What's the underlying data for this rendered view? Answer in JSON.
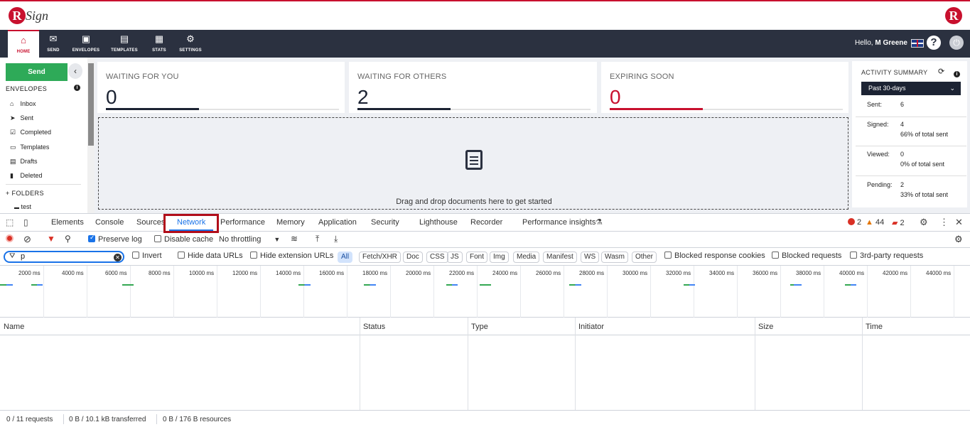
{
  "app": {
    "logo_text": "Sign",
    "logo_letter": "R",
    "nav": [
      {
        "label": "HOME",
        "icon": "home-icon",
        "glyph": "⌂"
      },
      {
        "label": "SEND",
        "icon": "envelope-icon",
        "glyph": "✉"
      },
      {
        "label": "ENVELOPES",
        "icon": "envelopes-icon",
        "glyph": "▣"
      },
      {
        "label": "TEMPLATES",
        "icon": "templates-icon",
        "glyph": "▤"
      },
      {
        "label": "STATS",
        "icon": "stats-icon",
        "glyph": "▦"
      },
      {
        "label": "SETTINGS",
        "icon": "gear-icon",
        "glyph": "⚙"
      }
    ],
    "greeting": "Hello,",
    "user_name": "M Greene",
    "help_glyph": "?",
    "power_glyph": "⏻"
  },
  "sidebar": {
    "send_label": "Send",
    "collapse_glyph": "‹",
    "envelopes_heading": "ENVELOPES",
    "info_glyph": "i",
    "items": [
      {
        "label": "Inbox",
        "glyph": "⌂"
      },
      {
        "label": "Sent",
        "glyph": "➤"
      },
      {
        "label": "Completed",
        "glyph": "☑"
      },
      {
        "label": "Templates",
        "glyph": "▭"
      },
      {
        "label": "Drafts",
        "glyph": "▤"
      },
      {
        "label": "Deleted",
        "glyph": "▮"
      }
    ],
    "folders_heading": "+ FOLDERS",
    "folder_items": [
      {
        "label": "test",
        "glyph": "▬"
      }
    ]
  },
  "dashboard": {
    "cards": [
      {
        "label": "WAITING FOR YOU",
        "value": "0"
      },
      {
        "label": "WAITING FOR OTHERS",
        "value": "2"
      },
      {
        "label": "EXPIRING SOON",
        "value": "0"
      }
    ],
    "drop_text": "Drag and drop documents here to get started"
  },
  "activity": {
    "title": "ACTIVITY SUMMARY",
    "period": "Past 30-days",
    "rows": [
      {
        "label": "Sent:",
        "value": "6",
        "pct": ""
      },
      {
        "label": "Signed:",
        "value": "4",
        "pct": "66% of total sent"
      },
      {
        "label": "Viewed:",
        "value": "0",
        "pct": "0% of total sent"
      },
      {
        "label": "Pending:",
        "value": "2",
        "pct": "33% of total sent"
      }
    ]
  },
  "devtools": {
    "tabs": [
      "Elements",
      "Console",
      "Sources",
      "Network",
      "Performance",
      "Memory",
      "Application",
      "Security",
      "Lighthouse",
      "Recorder",
      "Performance insights"
    ],
    "active_tab": "Network",
    "errors": "2",
    "warnings": "44",
    "issues": "2",
    "toolbar": {
      "preserve_log": "Preserve log",
      "disable_cache": "Disable cache",
      "throttling": "No throttling"
    },
    "filter": {
      "value": "p",
      "invert": "Invert",
      "hide_data_urls": "Hide data URLs",
      "hide_extension_urls": "Hide extension URLs",
      "chips": [
        "All",
        "Fetch/XHR",
        "Doc",
        "CSS",
        "JS",
        "Font",
        "Img",
        "Media",
        "Manifest",
        "WS",
        "Wasm",
        "Other"
      ],
      "blocked_cookies": "Blocked response cookies",
      "blocked_requests": "Blocked requests",
      "third_party": "3rd-party requests"
    },
    "timeline_ticks": [
      "2000 ms",
      "4000 ms",
      "6000 ms",
      "8000 ms",
      "10000 ms",
      "12000 ms",
      "14000 ms",
      "16000 ms",
      "18000 ms",
      "20000 ms",
      "22000 ms",
      "24000 ms",
      "26000 ms",
      "28000 ms",
      "30000 ms",
      "32000 ms",
      "34000 ms",
      "36000 ms",
      "38000 ms",
      "40000 ms",
      "42000 ms",
      "44000 ms"
    ],
    "columns": [
      "Name",
      "Status",
      "Type",
      "Initiator",
      "Size",
      "Time"
    ],
    "status": {
      "requests": "0 / 11 requests",
      "transferred": "0 B / 10.1 kB transferred",
      "resources": "0 B / 176 B resources"
    }
  },
  "colors": {
    "brand_red": "#c8102e",
    "nav_dark": "#2b3140",
    "send_green": "#2eaa58",
    "devtools_blue": "#1a73e8",
    "highlight_box": "#b10d1a"
  }
}
